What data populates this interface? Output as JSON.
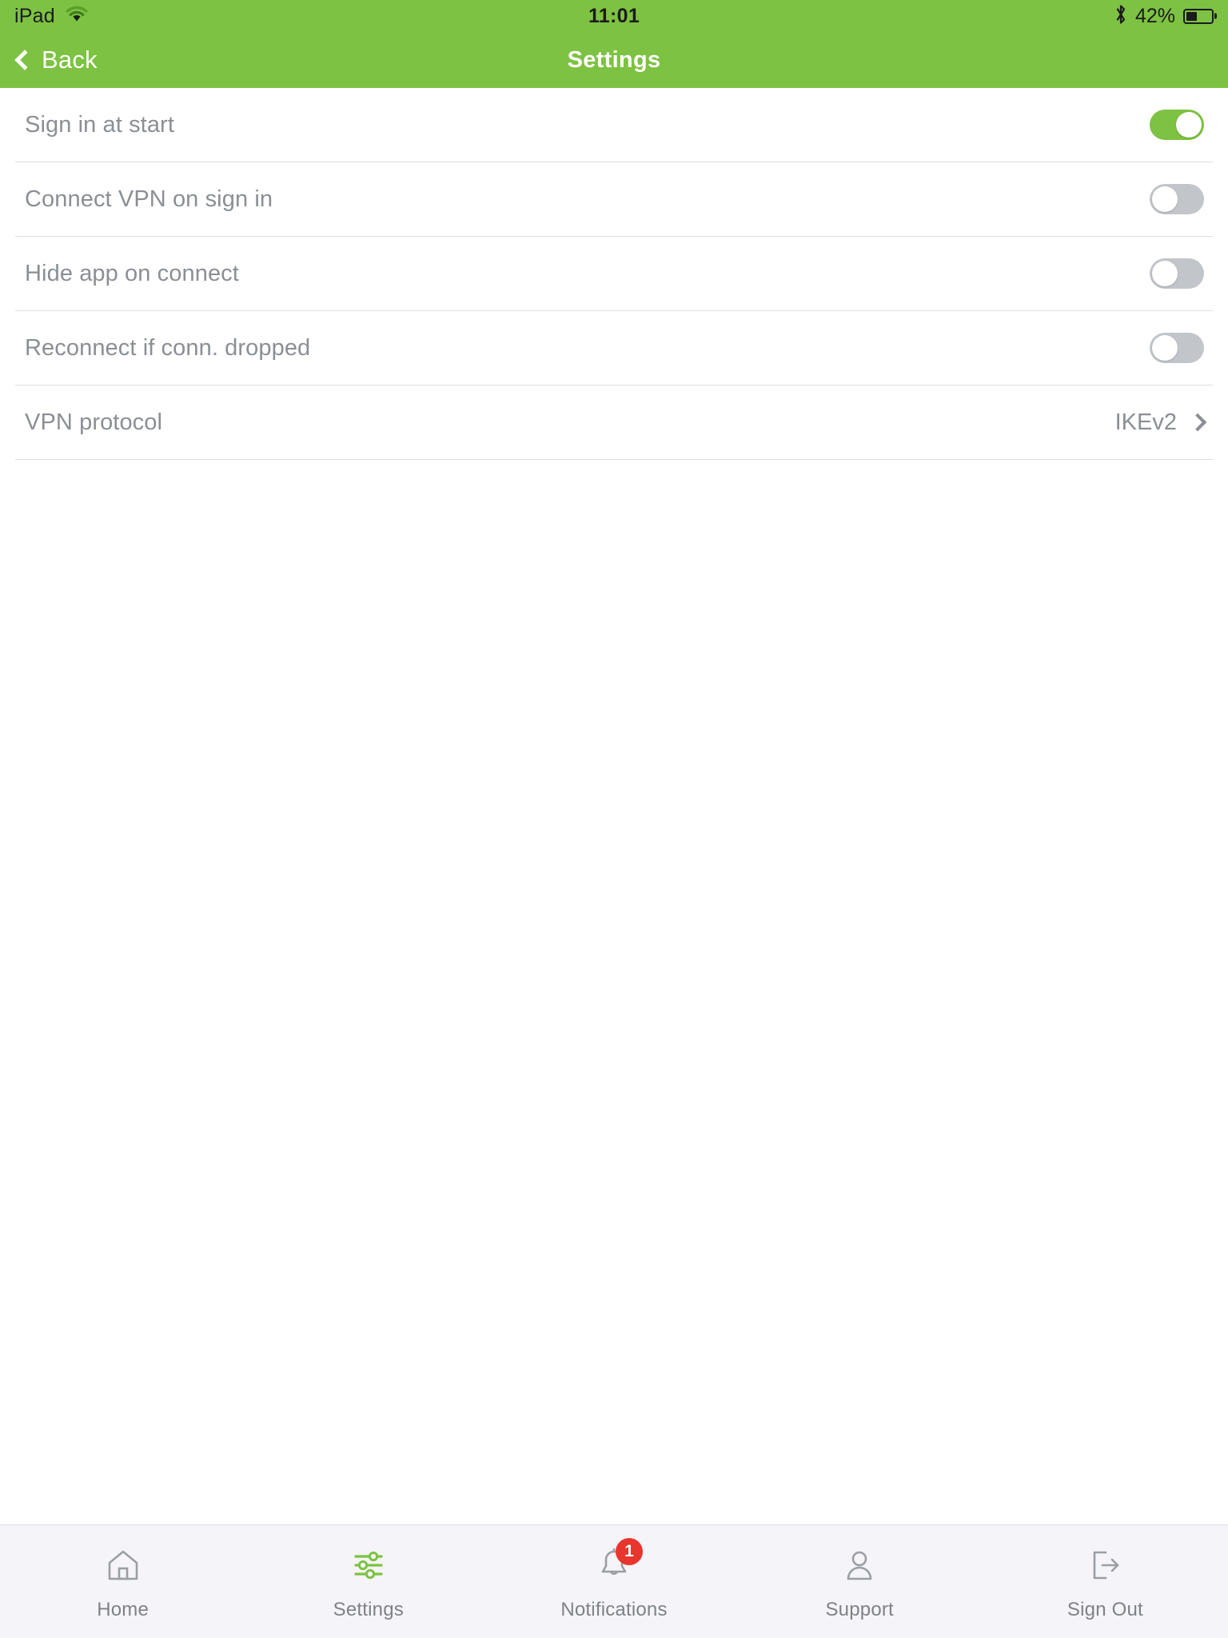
{
  "status_bar": {
    "device": "iPad",
    "wifi_icon": "wifi-icon",
    "time": "11:01",
    "bluetooth_icon": "bluetooth-icon",
    "battery_text": "42%",
    "battery_percent": 42,
    "battery_icon": "battery-icon"
  },
  "nav": {
    "back_label": "Back",
    "back_icon": "chevron-left-icon",
    "title": "Settings"
  },
  "settings": {
    "rows": [
      {
        "label": "Sign in at start",
        "type": "toggle",
        "value": "on"
      },
      {
        "label": "Connect VPN on sign in",
        "type": "toggle",
        "value": "off"
      },
      {
        "label": "Hide app on connect",
        "type": "toggle",
        "value": "off"
      },
      {
        "label": "Reconnect if conn. dropped",
        "type": "toggle",
        "value": "off"
      },
      {
        "label": "VPN protocol",
        "type": "disclosure",
        "value": "IKEv2",
        "chevron_icon": "chevron-right-icon"
      }
    ]
  },
  "tabbar": {
    "items": [
      {
        "label": "Home",
        "icon": "home-icon",
        "active": false,
        "badge": null
      },
      {
        "label": "Settings",
        "icon": "sliders-icon",
        "active": true,
        "badge": null
      },
      {
        "label": "Notifications",
        "icon": "bell-icon",
        "active": false,
        "badge": "1"
      },
      {
        "label": "Support",
        "icon": "person-icon",
        "active": false,
        "badge": null
      },
      {
        "label": "Sign Out",
        "icon": "sign-out-icon",
        "active": false,
        "badge": null
      }
    ]
  },
  "colors": {
    "brand_green": "#7DC242",
    "label_gray": "#8B8F94",
    "separator": "#DCDFE3",
    "tabbar_bg": "#F5F4F8",
    "badge_red": "#E8352E",
    "toggle_off": "#C2C6CA"
  }
}
